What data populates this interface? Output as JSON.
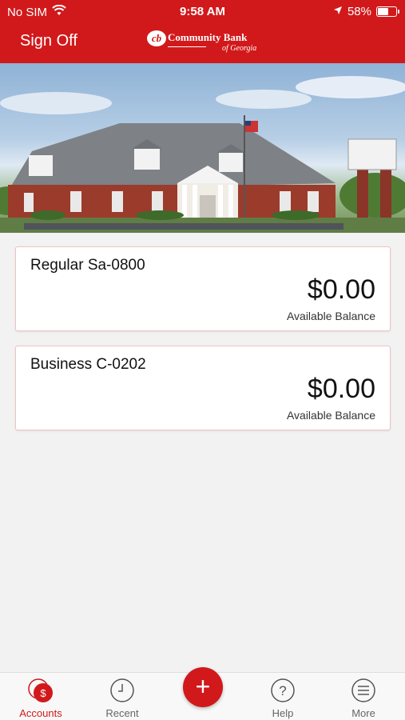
{
  "status_bar": {
    "carrier": "No SIM",
    "time": "9:58 AM",
    "battery": "58%",
    "battery_level": 0.58
  },
  "header": {
    "sign_off_label": "Sign Off",
    "logo": {
      "mark": "cb",
      "name": "Community Bank",
      "sub": "of Georgia"
    }
  },
  "accounts": [
    {
      "name": "Regular Sa-0800",
      "balance": "$0.00",
      "balance_label": "Available Balance"
    },
    {
      "name": "Business C-0202",
      "balance": "$0.00",
      "balance_label": "Available Balance"
    }
  ],
  "tab_bar": {
    "tabs": [
      {
        "label": "Accounts",
        "icon": "accounts-icon"
      },
      {
        "label": "Recent",
        "icon": "clock-icon"
      },
      {
        "label": "Help",
        "icon": "help-icon"
      },
      {
        "label": "More",
        "icon": "menu-icon"
      }
    ],
    "fab_icon": "plus-icon",
    "fab_glyph": "+",
    "accounts_badge": "$"
  },
  "colors": {
    "brand_red": "#d1191b"
  }
}
